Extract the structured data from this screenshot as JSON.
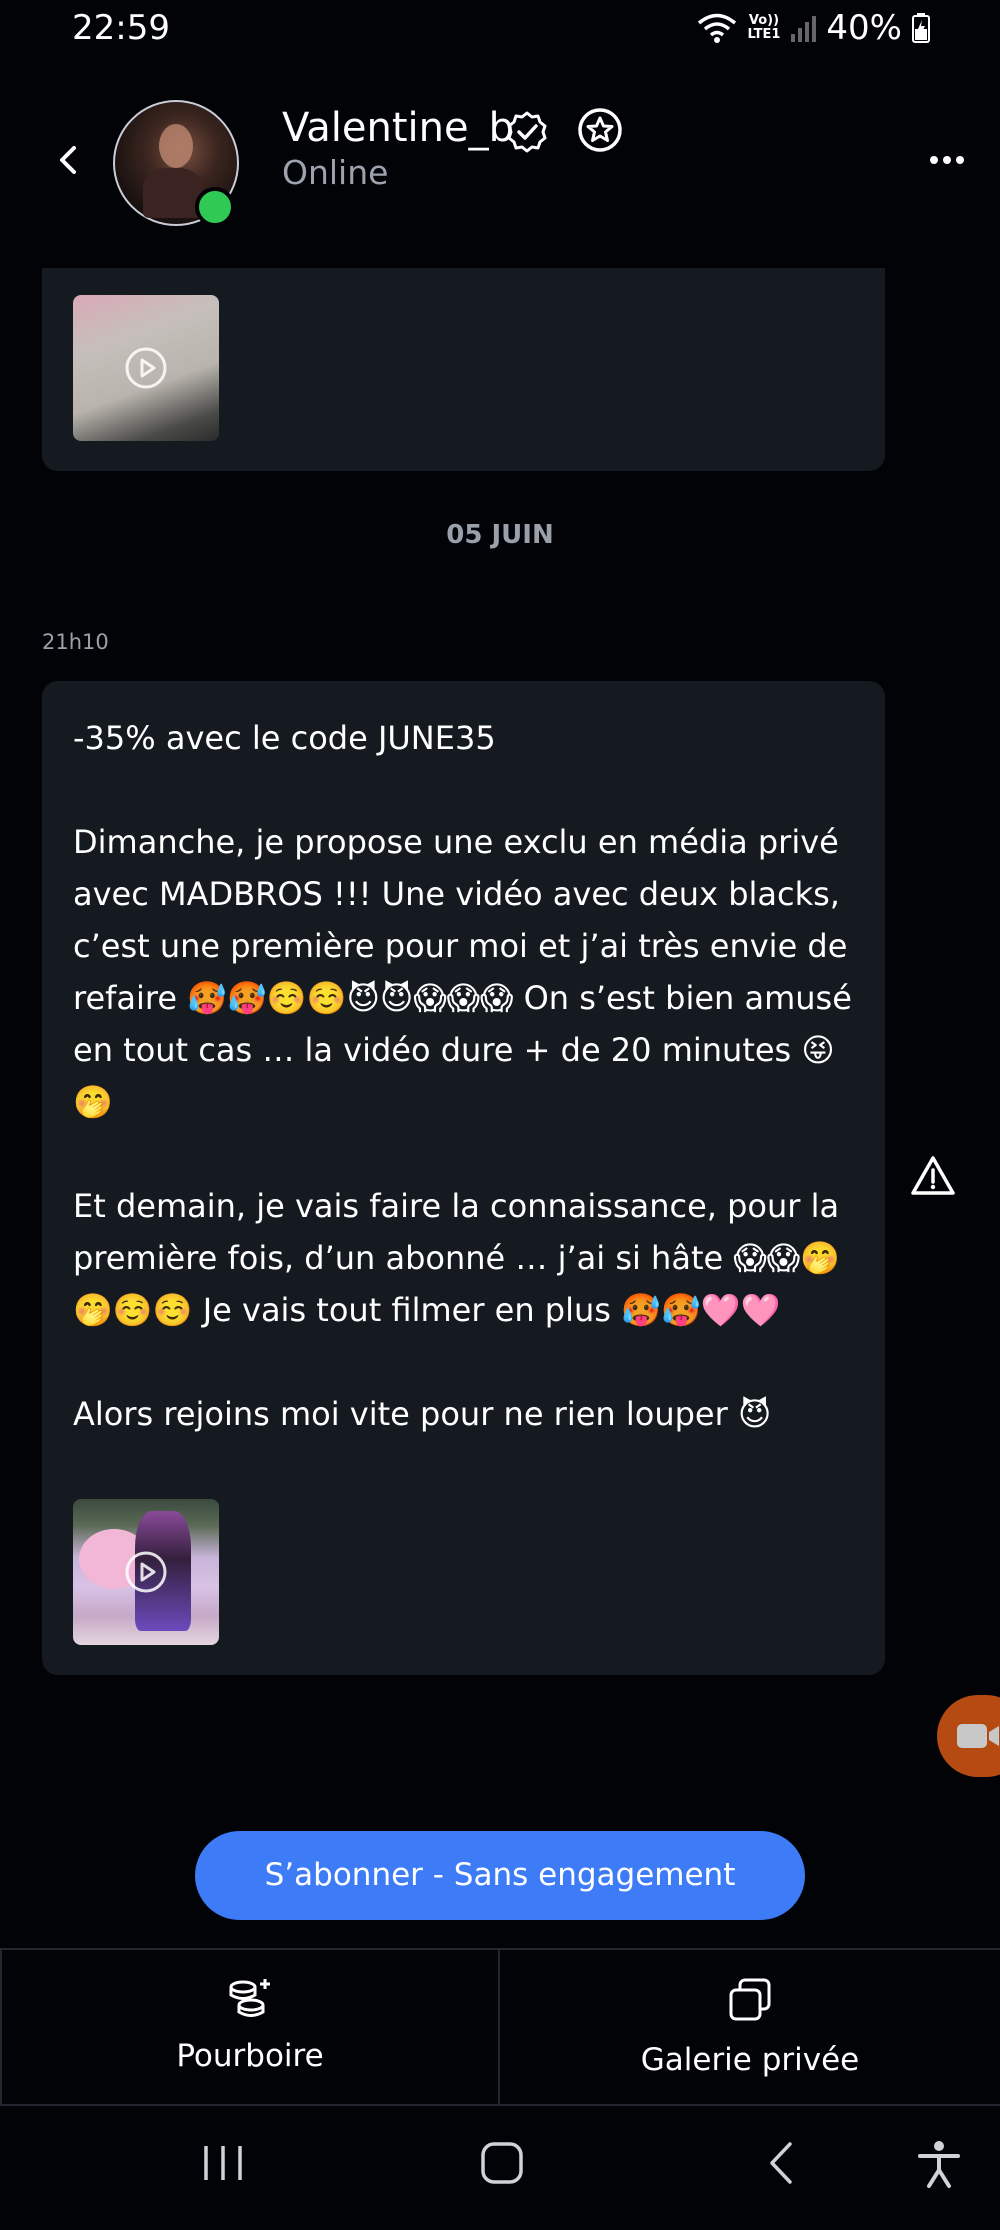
{
  "status_bar": {
    "time": "22:59",
    "network_top": "Vo))",
    "network_bottom": "LTE1",
    "battery": "40%"
  },
  "header": {
    "username": "Valentine_b",
    "status": "Online"
  },
  "feed": {
    "date_separator": "05 JUIN",
    "message_time": "21h10",
    "message_text": "-35% avec le code JUNE35\n\nDimanche, je propose une exclu en média privé avec MADBROS !!! Une vidéo avec deux blacks, c’est une première pour moi et j’ai très envie de refaire 🥵🥵☺️☺️😈😈😱😱😱 On s’est bien amusé en tout cas … la vidéo dure + de 20 minutes 😝🤭\n\nEt demain, je vais faire la connaissance, pour la première fois, d’un abonné … j’ai si hâte 😱😱🤭🤭☺️☺️ Je vais tout filmer en plus 🥵🥵🩷🩷\n\nAlors rejoins moi vite pour ne rien louper 😈"
  },
  "actions": {
    "subscribe_label": "S’abonner - Sans engagement",
    "tip_label": "Pourboire",
    "gallery_label": "Galerie privée"
  },
  "colors": {
    "background": "#020306",
    "bubble": "#151a21",
    "accent": "#3d7bf7",
    "online": "#2fc954",
    "fab": "#b54a12"
  },
  "icons": [
    "back-arrow-icon",
    "verified-icon",
    "star-icon",
    "more-icon",
    "play-icon",
    "warning-icon",
    "video-call-icon",
    "coins-plus-icon",
    "gallery-icon",
    "recent-apps-icon",
    "home-icon",
    "nav-back-icon",
    "accessibility-icon"
  ]
}
